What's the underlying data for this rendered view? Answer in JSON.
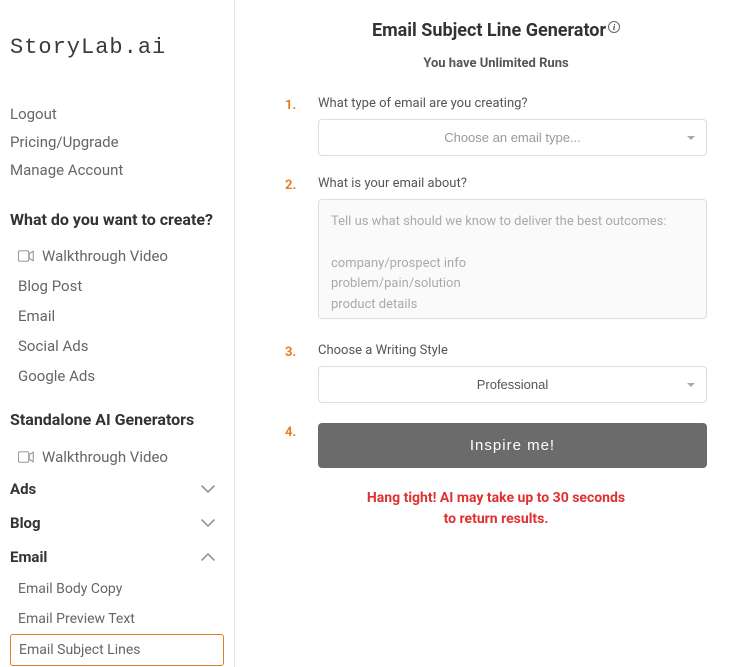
{
  "brand": "StoryLab.ai",
  "account_links": {
    "logout": "Logout",
    "pricing": "Pricing/Upgrade",
    "manage": "Manage Account"
  },
  "create_section": {
    "title": "What do you want to create?",
    "walkthrough": "Walkthrough Video",
    "items": [
      "Blog Post",
      "Email",
      "Social Ads",
      "Google Ads"
    ]
  },
  "standalone_section": {
    "title": "Standalone AI Generators",
    "walkthrough": "Walkthrough Video"
  },
  "accordion": {
    "ads": "Ads",
    "blog": "Blog",
    "email": "Email",
    "email_items": {
      "body": "Email Body Copy",
      "preview": "Email Preview Text",
      "subject": "Email Subject Lines"
    }
  },
  "main": {
    "title": "Email Subject Line Generator",
    "runs": "You have Unlimited Runs",
    "steps": {
      "s1": "1.",
      "s2": "2.",
      "s3": "3.",
      "s4": "4."
    },
    "q1_label": "What type of email are you creating?",
    "q1_placeholder": "Choose an email type...",
    "q2_label": "What is your email about?",
    "q2_placeholder": "Tell us what should we know to deliver the best outcomes:\n\ncompany/prospect info\nproblem/pain/solution\nproduct details\nyour secret sauce (Just kidding)",
    "q3_label": "Choose a Writing Style",
    "q3_value": "Professional",
    "button": "Inspire me!",
    "wait_l1": "Hang tight! AI may take up to 30 seconds",
    "wait_l2": "to return results."
  }
}
